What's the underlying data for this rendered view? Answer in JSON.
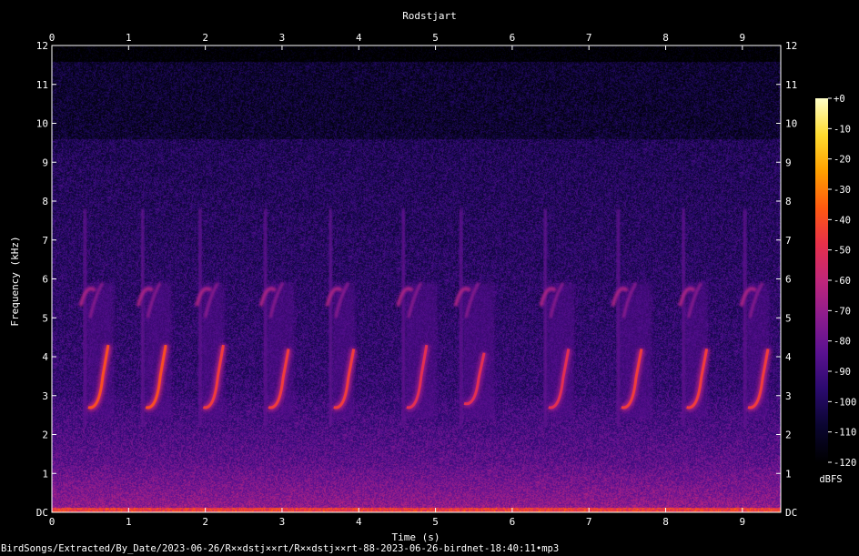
{
  "chart_data": {
    "type": "heatmap",
    "title": "Rodstjart",
    "xlabel": "Time (s)",
    "ylabel": "Frequency (kHz)",
    "xlim": [
      0,
      9.5
    ],
    "ylim": [
      0,
      12
    ],
    "x_ticks": [
      "0",
      "1",
      "2",
      "3",
      "4",
      "5",
      "6",
      "7",
      "8",
      "9"
    ],
    "y_ticks": [
      "DC",
      "1",
      "2",
      "3",
      "4",
      "5",
      "6",
      "7",
      "8",
      "9",
      "10",
      "11",
      "12"
    ],
    "colorbar": {
      "label": "dBFS",
      "ticks": [
        "+0",
        "-10",
        "-20",
        "-30",
        "-40",
        "-50",
        "-60",
        "-70",
        "-80",
        "-90",
        "-100",
        "-110",
        "-120"
      ],
      "range": [
        -120,
        0
      ],
      "colors": [
        "#000000",
        "#0a0530",
        "#2a0a6e",
        "#5a1190",
        "#8c1c8e",
        "#c0267a",
        "#e8304a",
        "#ff5a10",
        "#ffa000",
        "#ffdc30",
        "#ffffc8"
      ]
    },
    "song_phrases": [
      {
        "t_start": 0.45,
        "t_end": 0.75,
        "f_low_khz": 2.7,
        "f_high_khz": 4.3,
        "peak_db": -40
      },
      {
        "t_start": 1.2,
        "t_end": 1.5,
        "f_low_khz": 2.7,
        "f_high_khz": 4.3,
        "peak_db": -40
      },
      {
        "t_start": 1.95,
        "t_end": 2.2,
        "f_low_khz": 2.7,
        "f_high_khz": 4.3,
        "peak_db": -45
      },
      {
        "t_start": 2.8,
        "t_end": 3.1,
        "f_low_khz": 2.7,
        "f_high_khz": 4.2,
        "peak_db": -45
      },
      {
        "t_start": 3.65,
        "t_end": 3.9,
        "f_low_khz": 2.7,
        "f_high_khz": 4.2,
        "peak_db": -45
      },
      {
        "t_start": 4.6,
        "t_end": 4.95,
        "f_low_khz": 2.7,
        "f_high_khz": 4.3,
        "peak_db": -50
      },
      {
        "t_start": 5.35,
        "t_end": 5.7,
        "f_low_khz": 2.8,
        "f_high_khz": 4.1,
        "peak_db": -50
      },
      {
        "t_start": 6.45,
        "t_end": 6.75,
        "f_low_khz": 2.7,
        "f_high_khz": 4.2,
        "peak_db": -50
      },
      {
        "t_start": 7.4,
        "t_end": 7.75,
        "f_low_khz": 2.7,
        "f_high_khz": 4.2,
        "peak_db": -45
      },
      {
        "t_start": 8.25,
        "t_end": 8.5,
        "f_low_khz": 2.7,
        "f_high_khz": 4.2,
        "peak_db": -45
      },
      {
        "t_start": 9.05,
        "t_end": 9.3,
        "f_low_khz": 2.7,
        "f_high_khz": 4.2,
        "peak_db": -45
      }
    ],
    "grid": false
  },
  "footer_path": "BirdSongs/Extracted/By_Date/2023-06-26/R××dstj××rt/R××dstj××rt-88-2023-06-26-birdnet-18:40:11•mp3"
}
